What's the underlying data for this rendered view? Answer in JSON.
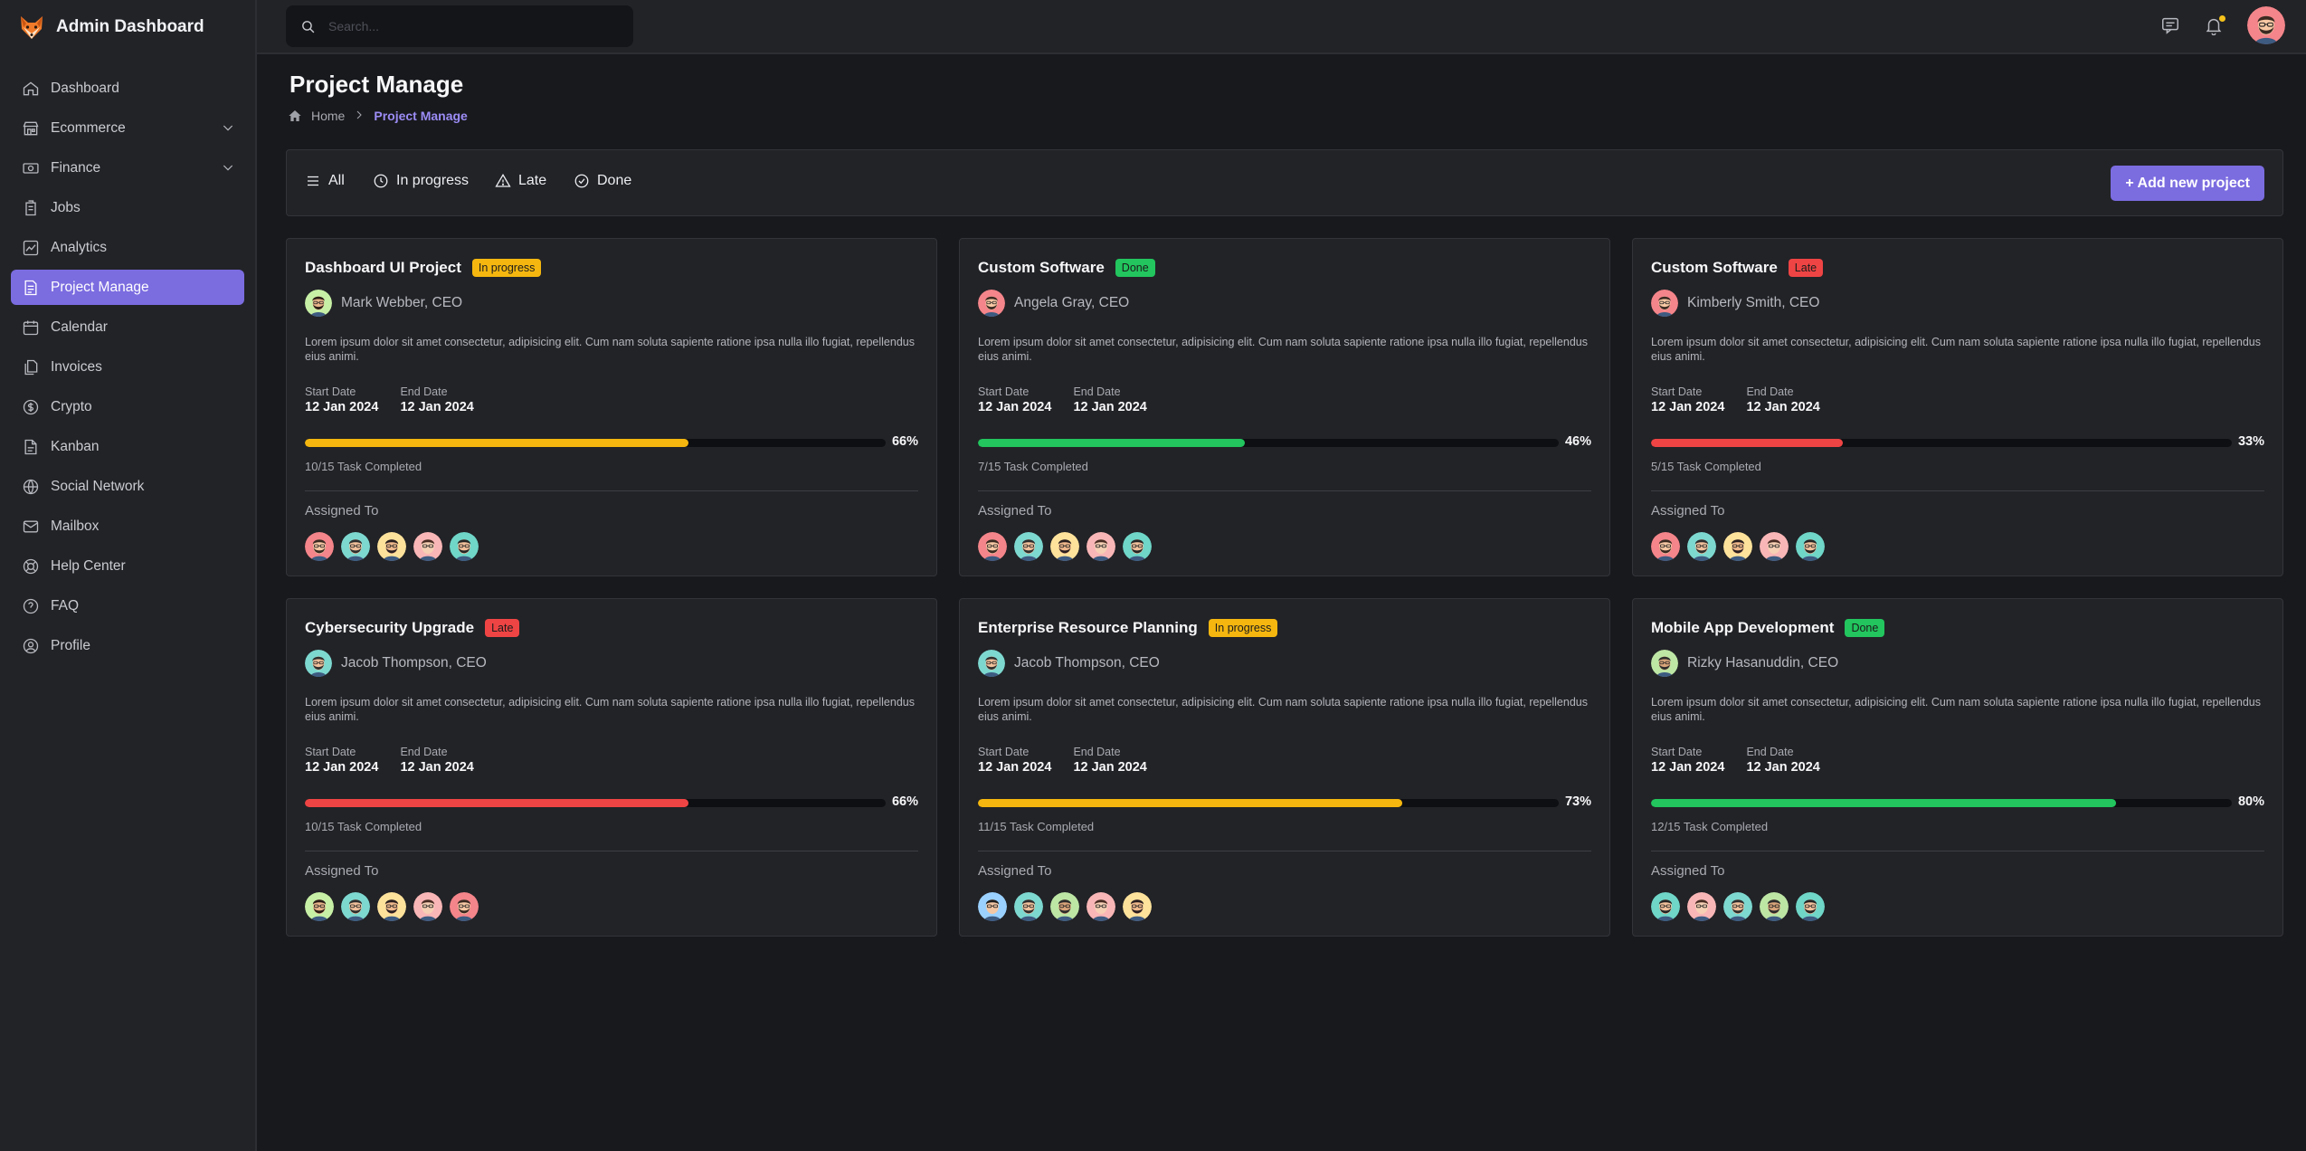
{
  "app": {
    "title": "Admin Dashboard"
  },
  "sidebar": {
    "items": [
      {
        "label": "Dashboard",
        "icon": "home-icon"
      },
      {
        "label": "Ecommerce",
        "icon": "store-icon",
        "expandable": true
      },
      {
        "label": "Finance",
        "icon": "money-icon",
        "expandable": true
      },
      {
        "label": "Jobs",
        "icon": "briefcase-icon"
      },
      {
        "label": "Analytics",
        "icon": "chart-icon"
      },
      {
        "label": "Project Manage",
        "icon": "document-icon",
        "active": true
      },
      {
        "label": "Calendar",
        "icon": "calendar-icon"
      },
      {
        "label": "Invoices",
        "icon": "invoice-icon"
      },
      {
        "label": "Crypto",
        "icon": "coin-icon"
      },
      {
        "label": "Kanban",
        "icon": "kanban-icon"
      },
      {
        "label": "Social Network",
        "icon": "globe-icon"
      },
      {
        "label": "Mailbox",
        "icon": "mail-icon"
      },
      {
        "label": "Help Center",
        "icon": "lifebuoy-icon"
      },
      {
        "label": "FAQ",
        "icon": "question-icon"
      },
      {
        "label": "Profile",
        "icon": "user-icon"
      }
    ]
  },
  "topbar": {
    "search_placeholder": "Search..."
  },
  "page": {
    "title": "Project Manage",
    "breadcrumb_home": "Home",
    "breadcrumb_current": "Project Manage"
  },
  "filters": {
    "all": "All",
    "in_progress": "In progress",
    "late": "Late",
    "done": "Done",
    "add_button": "+ Add new project"
  },
  "labels": {
    "start_date": "Start Date",
    "end_date": "End Date",
    "assigned_to": "Assigned To"
  },
  "colors": {
    "accent": "#7b6ce0",
    "in_progress": "#f5b70f",
    "done": "#22c55e",
    "late": "#ef4444"
  },
  "projects": [
    {
      "title": "Dashboard UI Project",
      "status": "In progress",
      "status_color": "#f5b70f",
      "owner": "Mark Webber, CEO",
      "description": "Lorem ipsum dolor sit amet consectetur, adipisicing elit. Cum nam soluta sapiente ratione ipsa nulla illo fugiat, repellendus eius animi.",
      "start_date": "12 Jan 2024",
      "end_date": "12 Jan 2024",
      "progress": 66,
      "progress_label": "66%",
      "progress_color": "#f5b70f",
      "tasks": "10/15 Task Completed"
    },
    {
      "title": "Custom Software",
      "status": "Done",
      "status_color": "#22c55e",
      "owner": "Angela Gray, CEO",
      "description": "Lorem ipsum dolor sit amet consectetur, adipisicing elit. Cum nam soluta sapiente ratione ipsa nulla illo fugiat, repellendus eius animi.",
      "start_date": "12 Jan 2024",
      "end_date": "12 Jan 2024",
      "progress": 46,
      "progress_label": "46%",
      "progress_color": "#22c55e",
      "tasks": "7/15 Task Completed"
    },
    {
      "title": "Custom Software",
      "status": "Late",
      "status_color": "#ef4444",
      "owner": "Kimberly Smith, CEO",
      "description": "Lorem ipsum dolor sit amet consectetur, adipisicing elit. Cum nam soluta sapiente ratione ipsa nulla illo fugiat, repellendus eius animi.",
      "start_date": "12 Jan 2024",
      "end_date": "12 Jan 2024",
      "progress": 33,
      "progress_label": "33%",
      "progress_color": "#ef4444",
      "tasks": "5/15 Task Completed"
    },
    {
      "title": "Cybersecurity Upgrade",
      "status": "Late",
      "status_color": "#ef4444",
      "owner": "Jacob Thompson, CEO",
      "description": "Lorem ipsum dolor sit amet consectetur, adipisicing elit. Cum nam soluta sapiente ratione ipsa nulla illo fugiat, repellendus eius animi.",
      "start_date": "12 Jan 2024",
      "end_date": "12 Jan 2024",
      "progress": 66,
      "progress_label": "66%",
      "progress_color": "#ef4444",
      "tasks": "10/15 Task Completed"
    },
    {
      "title": "Enterprise Resource Planning",
      "status": "In progress",
      "status_color": "#f5b70f",
      "owner": "Jacob Thompson, CEO",
      "description": "Lorem ipsum dolor sit amet consectetur, adipisicing elit. Cum nam soluta sapiente ratione ipsa nulla illo fugiat, repellendus eius animi.",
      "start_date": "12 Jan 2024",
      "end_date": "12 Jan 2024",
      "progress": 73,
      "progress_label": "73%",
      "progress_color": "#f5b70f",
      "tasks": "11/15 Task Completed"
    },
    {
      "title": "Mobile App Development",
      "status": "Done",
      "status_color": "#22c55e",
      "owner": "Rizky Hasanuddin, CEO",
      "description": "Lorem ipsum dolor sit amet consectetur, adipisicing elit. Cum nam soluta sapiente ratione ipsa nulla illo fugiat, repellendus eius animi.",
      "start_date": "12 Jan 2024",
      "end_date": "12 Jan 2024",
      "progress": 80,
      "progress_label": "80%",
      "progress_color": "#22c55e",
      "tasks": "12/15 Task Completed"
    }
  ]
}
